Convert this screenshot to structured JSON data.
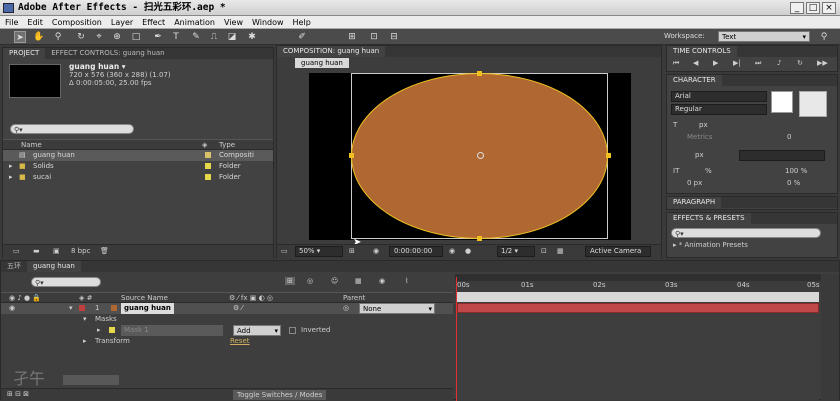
{
  "app": {
    "title": "Adobe After Effects - 扫光五彩环.aep *"
  },
  "menu": [
    "File",
    "Edit",
    "Composition",
    "Layer",
    "Effect",
    "Animation",
    "View",
    "Window",
    "Help"
  ],
  "toolbar": {
    "workspace_label": "Workspace:",
    "workspace_value": "Text"
  },
  "project": {
    "tab_label": "PROJECT",
    "effects_tab": "EFFECT CONTROLS: guang huan",
    "item_name": "guang huan ▾",
    "item_size": "720 x 576  (360 x 288) (1.07)",
    "item_duration": "Δ 0:00:05:00, 25.00 fps",
    "col_name": "Name",
    "col_type": "Type",
    "rows": [
      {
        "name": "guang huan",
        "type": "Compositi",
        "color": "#d8c26a"
      },
      {
        "name": "Solids",
        "type": "Folder",
        "color": "#e4d84a"
      },
      {
        "name": "sucai",
        "type": "Folder",
        "color": "#e4d84a"
      }
    ],
    "bpc": "8 bpc"
  },
  "comp": {
    "tab_label": "COMPOSITION: guang huan",
    "subtab": "guang huan",
    "zoom": "50%",
    "timecode": "0:00:00:00",
    "resolution": "1/2",
    "camera": "Active Camera",
    "shape_color": "#b06833",
    "outline_color": "#f0c020"
  },
  "right": {
    "time_controls": "TIME CONTROLS",
    "character": "CHARACTER",
    "font": "Arial",
    "style": "Regular",
    "size_unit": "px",
    "metrics": "Metrics",
    "tracking_value": "0",
    "leading_unit": "px",
    "vscale": "100 %",
    "hscale_unit": "%",
    "baseline": "0 px",
    "tsume": "0 %",
    "paragraph": "PARAGRAPH",
    "effects_presets": "EFFECTS & PRESETS",
    "preset_item": "* Animation Presets"
  },
  "timeline": {
    "tab1": "五环",
    "tab2": "guang huan",
    "col_source": "Source Name",
    "col_parent": "Parent",
    "layer_num": "1",
    "layer_name": "guang huan",
    "parent_value": "None",
    "masks": "Masks",
    "mask_name": "Mask 1",
    "mask_mode": "Add",
    "inverted": "Inverted",
    "transform": "Transform",
    "reset": "Reset",
    "ruler": [
      "00s",
      "01s",
      "02s",
      "03s",
      "04s",
      "05s"
    ],
    "toggle": "Toggle Switches / Modes"
  }
}
